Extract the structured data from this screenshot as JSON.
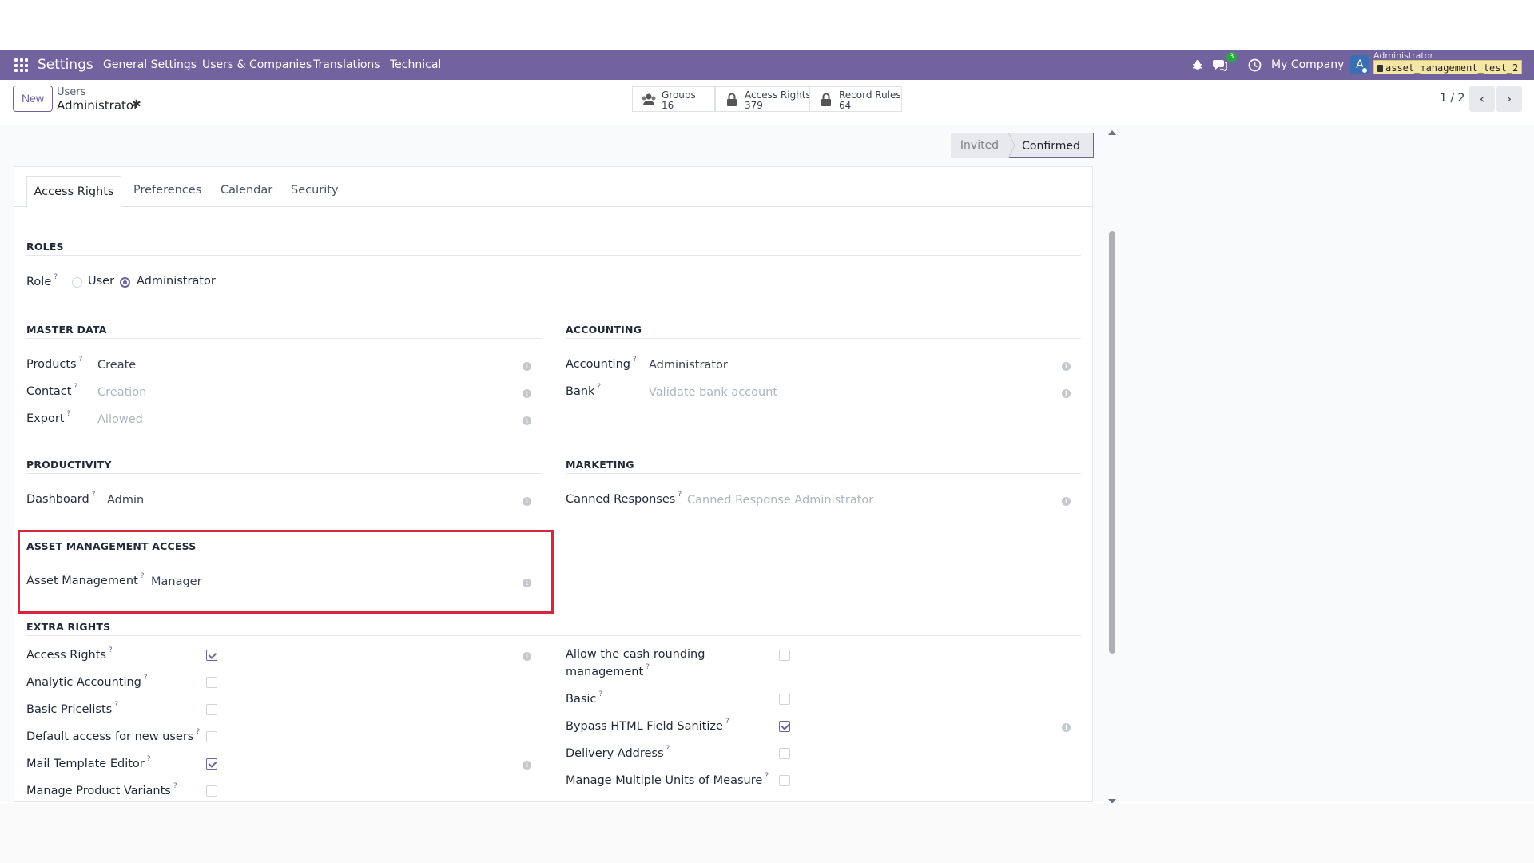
{
  "navbar": {
    "app_name": "Settings",
    "menus": [
      "General Settings",
      "Users & Companies",
      "Translations",
      "Technical"
    ],
    "chat_count": "3",
    "company": "My Company",
    "avatar_letter": "A",
    "user_name": "Administrator",
    "database": "asset_management_test_2",
    "color": "#71639e"
  },
  "control": {
    "new_label": "New",
    "breadcrumb_parent": "Users",
    "breadcrumb_current": "Administrator",
    "smart_buttons": [
      {
        "label": "Groups",
        "value": "16",
        "icon": "users-icon"
      },
      {
        "label": "Access Rights",
        "value": "379",
        "icon": "lock-icon"
      },
      {
        "label": "Record Rules",
        "value": "64",
        "icon": "lock-icon"
      }
    ],
    "pager": "1 / 2"
  },
  "status": {
    "invited": "Invited",
    "confirmed": "Confirmed"
  },
  "tabs": [
    "Access Rights",
    "Preferences",
    "Calendar",
    "Security"
  ],
  "roles": {
    "title": "ROLES",
    "role_label": "Role",
    "options": [
      "User",
      "Administrator"
    ],
    "selected": "Administrator"
  },
  "master_data": {
    "title": "MASTER DATA",
    "fields": [
      {
        "label": "Products",
        "value": "Create"
      },
      {
        "label": "Contact",
        "value": "Creation"
      },
      {
        "label": "Export",
        "value": "Allowed"
      }
    ]
  },
  "accounting": {
    "title": "ACCOUNTING",
    "fields": [
      {
        "label": "Accounting",
        "value": "Administrator"
      },
      {
        "label": "Bank",
        "value": "Validate bank account"
      }
    ]
  },
  "productivity": {
    "title": "PRODUCTIVITY",
    "fields": [
      {
        "label": "Dashboard",
        "value": "Admin"
      }
    ]
  },
  "marketing": {
    "title": "MARKETING",
    "fields": [
      {
        "label": "Canned Responses",
        "value": "Canned Response Administrator"
      }
    ]
  },
  "asset_access": {
    "title": "ASSET MANAGEMENT ACCESS",
    "fields": [
      {
        "label": "Asset Management",
        "value": "Manager"
      }
    ]
  },
  "extra_rights": {
    "title": "EXTRA RIGHTS",
    "left": [
      {
        "label": "Access Rights",
        "checked": true
      },
      {
        "label": "Analytic Accounting",
        "checked": false
      },
      {
        "label": "Basic Pricelists",
        "checked": false
      },
      {
        "label": "Default access for new users",
        "checked": false
      },
      {
        "label": "Mail Template Editor",
        "checked": true
      },
      {
        "label": "Manage Product Variants",
        "checked": false
      }
    ],
    "right": [
      {
        "label_line1": "Allow the cash rounding",
        "label_line2": "management",
        "checked": false
      },
      {
        "label": "Basic",
        "checked": false
      },
      {
        "label": "Bypass HTML Field Sanitize",
        "checked": true
      },
      {
        "label": "Delivery Address",
        "checked": false
      },
      {
        "label": "Manage Multiple Units of Measure",
        "checked": false
      }
    ]
  },
  "help_mark": "?",
  "info_mark": "i",
  "gear_glyph": "✱"
}
